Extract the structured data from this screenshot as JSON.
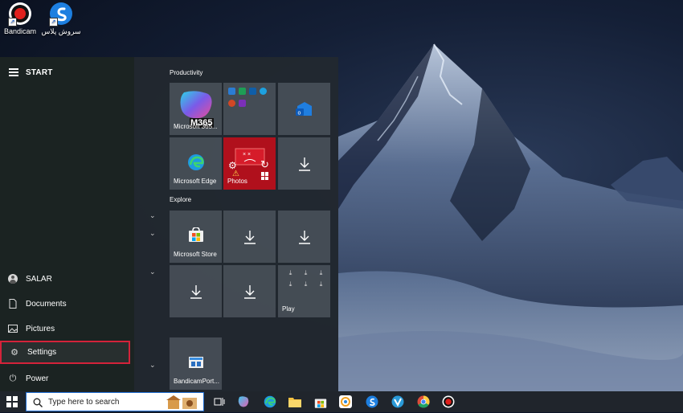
{
  "desktop": {
    "icons": [
      {
        "label": "Bandicam",
        "icon": "bandicam-record-icon"
      },
      {
        "label": "سروش پلاس",
        "icon": "soroush-plus-icon"
      }
    ]
  },
  "start_menu": {
    "title": "START",
    "nav": {
      "user": "SALAR",
      "documents": "Documents",
      "pictures": "Pictures",
      "settings": "Settings",
      "power": "Power"
    },
    "groups": {
      "productivity": "Productivity",
      "explore": "Explore"
    },
    "tiles": {
      "m365": {
        "badge": "M365",
        "label": "Microsoft 365..."
      },
      "edge": "Microsoft Edge",
      "photos": "Photos",
      "store": "Microsoft Store",
      "play": "Play",
      "bandicam": "BandicamPort..."
    }
  },
  "taskbar": {
    "search_placeholder": "Type here to search",
    "apps": [
      "copilot-icon",
      "edge-icon",
      "file-explorer-icon",
      "store-icon",
      "photos-icon",
      "soroush-icon",
      "vivaldi-icon",
      "chrome-icon",
      "bandicam-icon"
    ]
  },
  "colors": {
    "highlight_border": "#d4233a",
    "search_border": "#1d6bd0",
    "photos_tile": "#b0101c"
  }
}
